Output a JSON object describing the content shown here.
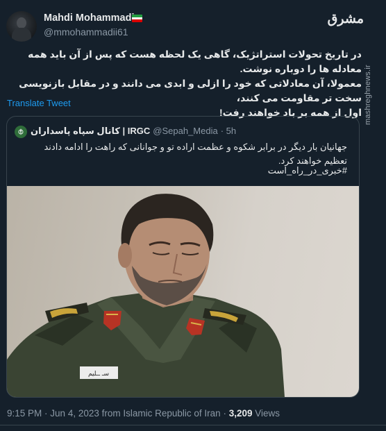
{
  "author": {
    "name": "Mahdi Mohammadi",
    "handle": "@mmohammadii61",
    "flag": "iran-flag-icon"
  },
  "brand": {
    "logo_text": "مشرق",
    "watermark": "mashreghnews.ir"
  },
  "tweet": {
    "text": "در تاریخ تحولات استراتژیک، گاهی یک لحظه هست که پس از آن باید همه معادله ها را دوباره نوشت.\nمعمولا، آن معادلاتی که خود را ازلی و ابدی می دانند و در مقابل بازنویسی سخت تر مقاومت می کنند،\nاول از همه بر باد خواهند رفت!",
    "translate_label": "Translate Tweet"
  },
  "quote": {
    "name": "کانال سپاه پاسداران | IRGC",
    "handle": "@Sepah_Media",
    "time": "· 5h",
    "text": "جهانیان بار دیگر در برابر شکوه و عظمت اراده تو و جوانانی که راهت را ادامه دادند تعظیم خواهند کرد.",
    "hashtag": "#خبری_در_راه_است",
    "name_tag_text": "سـ ــلیم"
  },
  "meta": {
    "time": "9:15 PM",
    "date": "Jun 4, 2023",
    "location": "from Islamic Republic of Iran",
    "views_count": "3,209",
    "views_label": "Views"
  },
  "colors": {
    "background": "#15202b",
    "link": "#1d9bf0",
    "secondary_text": "#8b98a5",
    "border": "#38444d"
  }
}
